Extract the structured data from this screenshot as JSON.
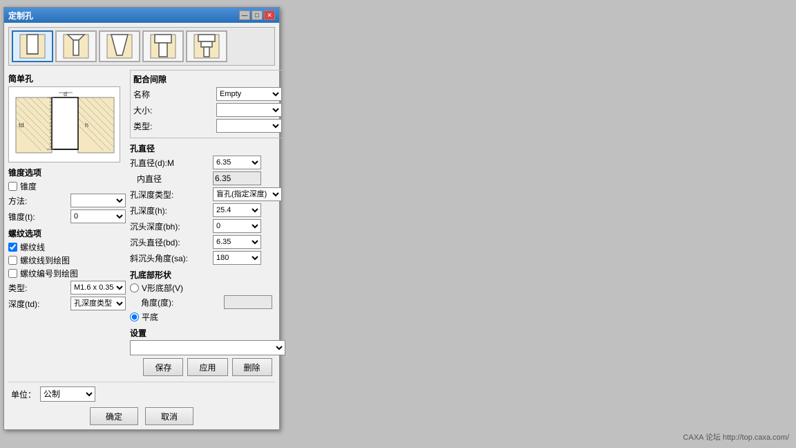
{
  "window": {
    "title": "定制孔"
  },
  "title_buttons": {
    "minimize": "—",
    "maximize": "□",
    "close": "✕"
  },
  "hole_types": [
    {
      "label": "简单孔",
      "active": true
    },
    {
      "label": "沉头孔",
      "active": false
    },
    {
      "label": "锥形孔",
      "active": false
    },
    {
      "label": "台阶孔",
      "active": false
    },
    {
      "label": "复合孔",
      "active": false
    }
  ],
  "left_panel": {
    "section_label": "简单孔",
    "taper_section": "锥度选项",
    "taper_checkbox": "锥度",
    "method_label": "方法:",
    "taper_label": "锥度(t):",
    "taper_value": "0",
    "thread_section": "螺纹选项",
    "thread_line_cb": "螺纹线",
    "thread_to_drawing_cb": "螺纹线到绘图",
    "thread_num_to_drawing_cb": "螺纹编号到绘图",
    "type_label": "类型:",
    "type_value": "M1.6 x 0.35",
    "depth_label": "深度(td):",
    "depth_value": "孔深度类型"
  },
  "right_panel": {
    "peihe_title": "配合间隙",
    "name_label": "名称",
    "name_value": "Empty",
    "size_label": "大小:",
    "type_label": "类型:",
    "hole_diameter_section": "孔直径",
    "hole_d_label": "孔直径(d):M",
    "hole_d_value": "6.35",
    "inner_d_label": "内直径",
    "inner_d_value": "6.35",
    "depth_type_label": "孔深度类型:",
    "depth_type_value": "盲孔(指定深度)",
    "depth_h_label": "孔深度(h):",
    "depth_h_value": "25.4",
    "sink_depth_label": "沉头深度(bh):",
    "sink_depth_value": "0",
    "sink_diameter_label": "沉头直径(bd):",
    "sink_diameter_value": "6.35",
    "angle_sink_label": "斜沉头角度(sa):",
    "angle_sink_value": "180",
    "bottom_shape_section": "孔底部形状",
    "v_bottom_label": "V形底部(V)",
    "angle_label": "角度(度):",
    "flat_label": "平底",
    "settings_section": "设置",
    "save_btn": "保存",
    "apply_btn": "应用",
    "delete_btn": "删除",
    "unit_label": "单位：",
    "unit_value": "公制"
  },
  "ok_btn": "确定",
  "cancel_btn": "取消",
  "watermark": "CAXA 论坛  http://top.caxa.com/"
}
